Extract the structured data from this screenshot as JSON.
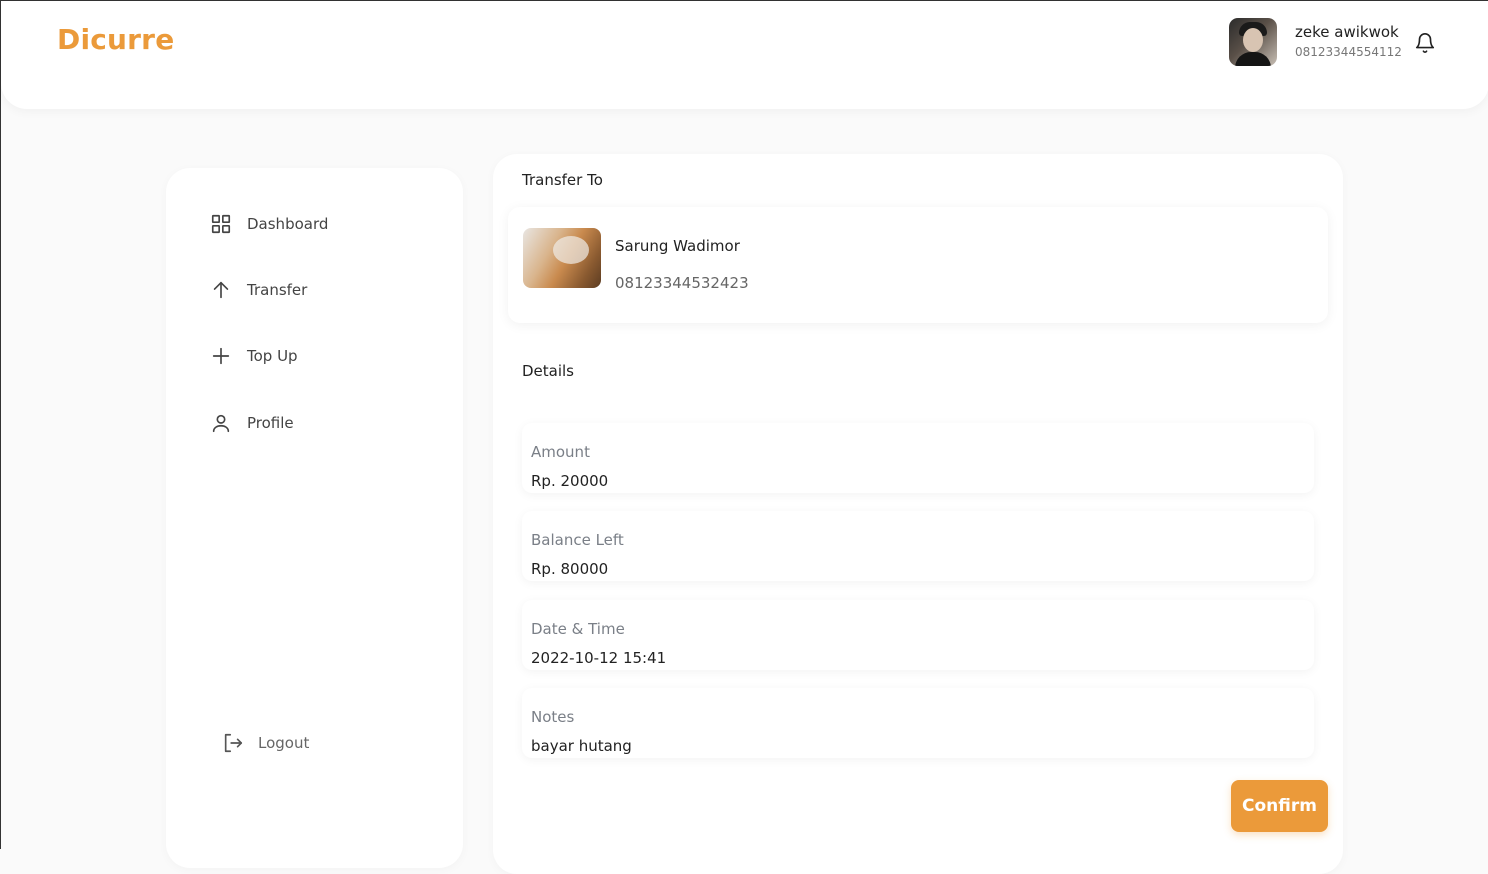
{
  "brand": "Dicurre",
  "user": {
    "name": "zeke awikwok",
    "phone": "08123344554112"
  },
  "sidebar": {
    "items": [
      {
        "label": "Dashboard",
        "icon": "grid-icon"
      },
      {
        "label": "Transfer",
        "icon": "arrow-up-icon"
      },
      {
        "label": "Top Up",
        "icon": "plus-icon"
      },
      {
        "label": "Profile",
        "icon": "user-icon"
      }
    ],
    "logout_label": "Logout"
  },
  "main": {
    "transfer_to_title": "Transfer To",
    "recipient": {
      "name": "Sarung Wadimor",
      "phone": "08123344532423"
    },
    "details_title": "Details",
    "details": [
      {
        "label": "Amount",
        "value": "Rp. 20000"
      },
      {
        "label": "Balance Left",
        "value": "Rp. 80000"
      },
      {
        "label": "Date & Time",
        "value": "2022-10-12 15:41"
      },
      {
        "label": "Notes",
        "value": "bayar hutang"
      }
    ],
    "confirm_label": "Confirm"
  },
  "colors": {
    "accent": "#eb9a3a",
    "background": "#fafafa",
    "card": "#ffffff",
    "muted_text": "#7a7f87"
  }
}
